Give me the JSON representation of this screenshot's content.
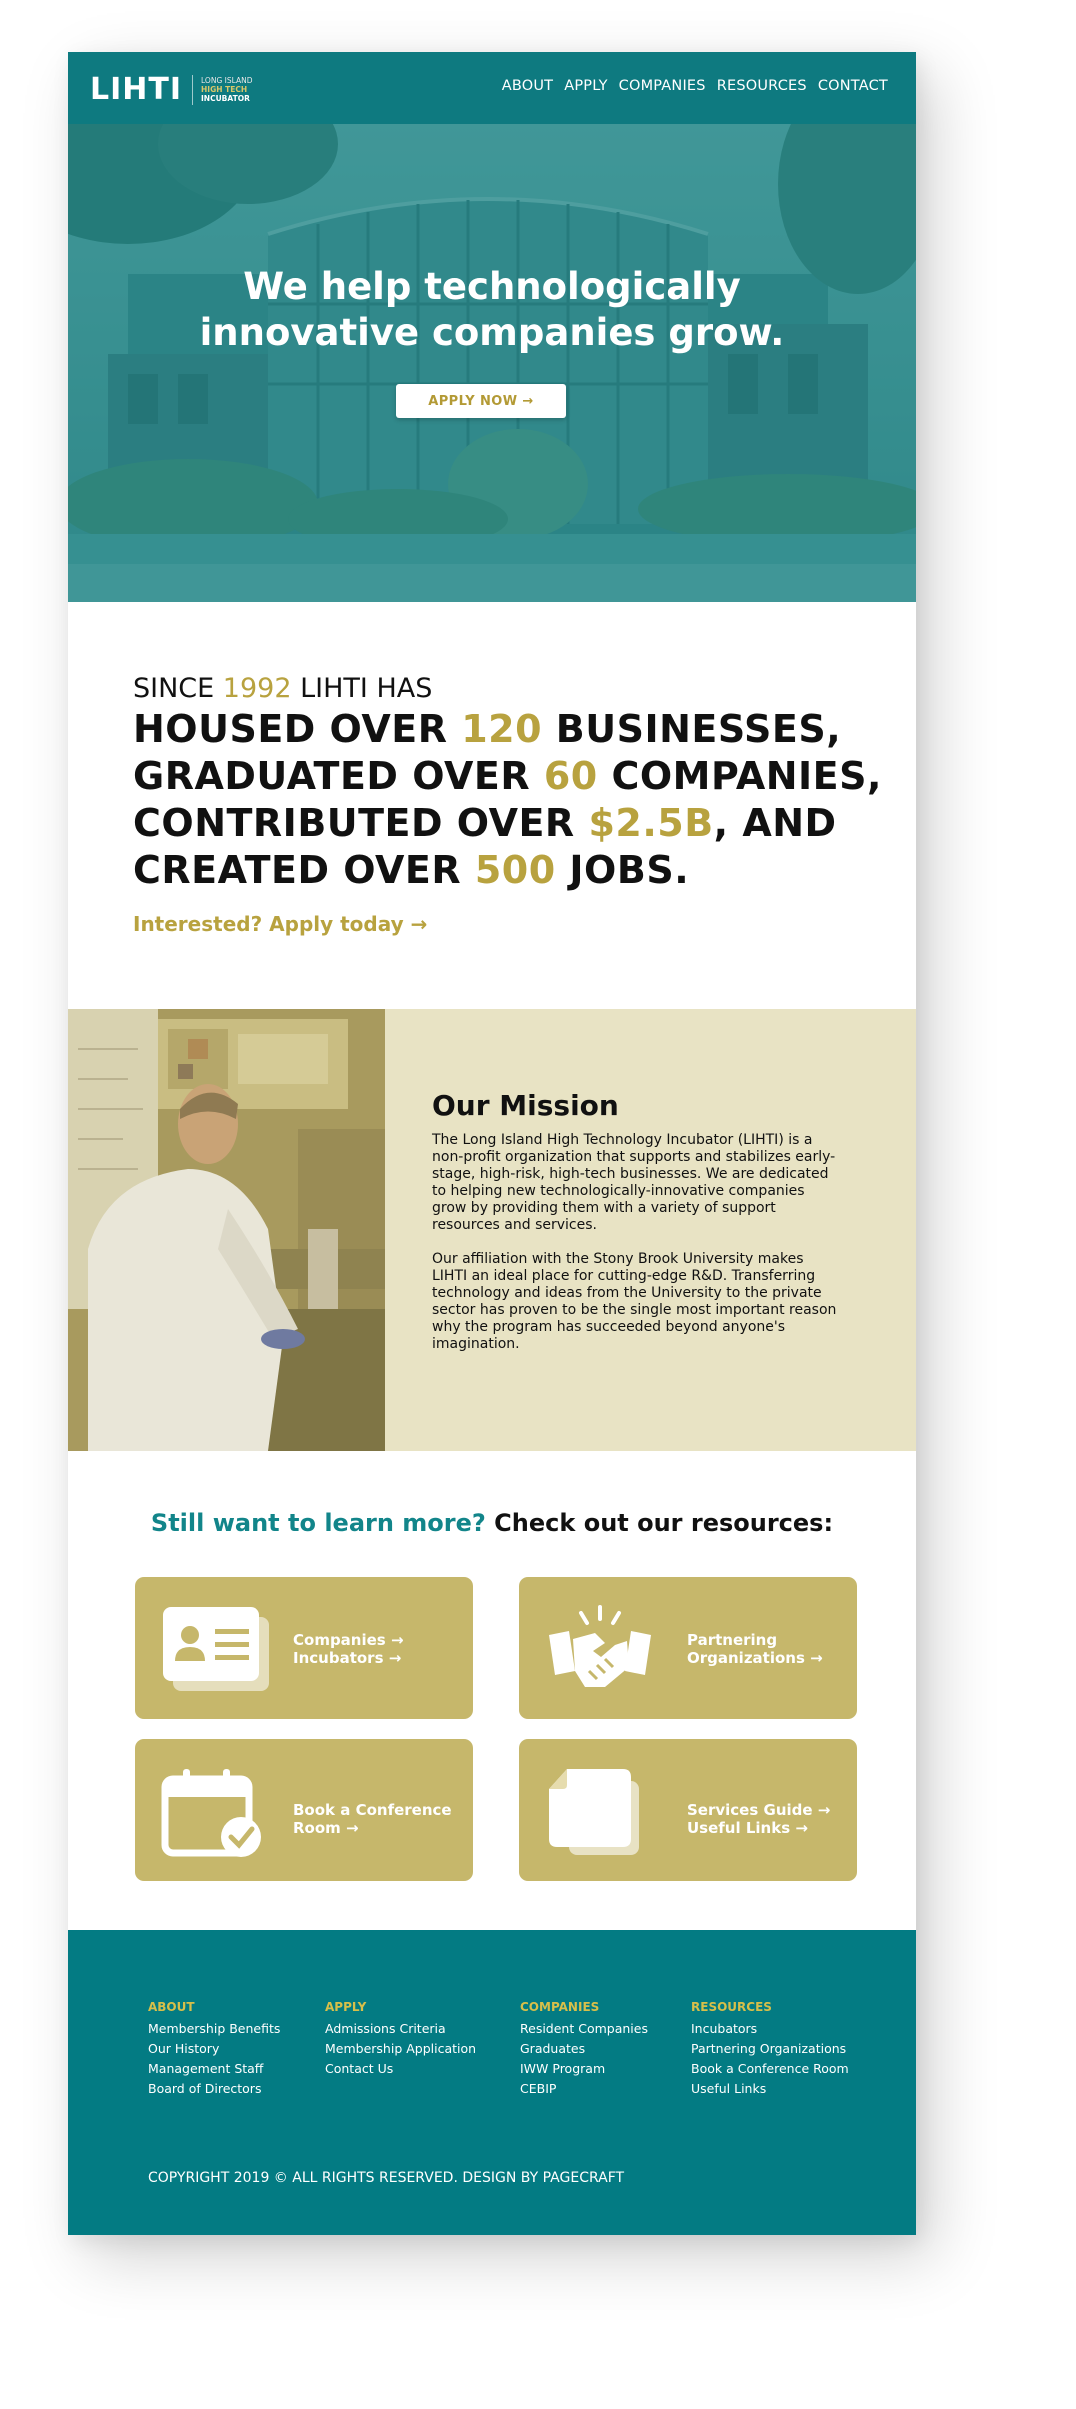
{
  "nav": {
    "logo_main": "LIHTI",
    "logo_line1": "LONG ISLAND",
    "logo_line2": "HIGH TECH",
    "logo_line3": "INCUBATOR",
    "items": [
      {
        "label": "ABOUT"
      },
      {
        "label": "APPLY"
      },
      {
        "label": "COMPANIES"
      },
      {
        "label": "RESOURCES"
      },
      {
        "label": "CONTACT"
      }
    ]
  },
  "hero": {
    "title_line1": "We help technologically",
    "title_line2": "innovative companies grow.",
    "button_label": "APPLY NOW →"
  },
  "stats": {
    "since_prefix": "SINCE ",
    "since_year": "1992",
    "since_suffix": " LIHTI HAS",
    "line1_a": "HOUSED OVER ",
    "line1_num": "120",
    "line1_b": " BUSINESSES,",
    "line2_a": "GRADUATED OVER ",
    "line2_num": "60",
    "line2_b": " COMPANIES,",
    "line3_a": "CONTRIBUTED OVER ",
    "line3_num": "$2.5B",
    "line3_b": ", AND",
    "line4_a": "CREATED OVER ",
    "line4_num": "500",
    "line4_b": " JOBS.",
    "cta": "Interested? Apply today →"
  },
  "mission": {
    "title": "Our Mission",
    "p1": "The Long Island High Technology Incubator (LIHTI) is a non-profit organization that supports and stabilizes early-stage, high-risk, high-tech businesses. We are dedicated to helping new technologically-innovative companies grow by providing them with a variety of support resources and services.",
    "p2": "Our affiliation with the Stony Brook University makes LIHTI an ideal place for cutting-edge R&D.  Transferring technology and ideas from the University to the private sector has proven to be the single most important reason why the program has succeeded beyond anyone's imagination."
  },
  "resources": {
    "heading_teal": "Still want to learn more?",
    "heading_dark": " Check out our resources:",
    "cards": [
      {
        "line1": "Companies →",
        "line2": "Incubators →"
      },
      {
        "line1": "Partnering",
        "line2": "Organizations →"
      },
      {
        "line1": "Book a Conference",
        "line2": "Room →"
      },
      {
        "line1": "Services Guide →",
        "line2": "Useful Links →"
      }
    ]
  },
  "footer": {
    "columns": [
      {
        "title": "ABOUT",
        "links": [
          "Membership Benefits",
          "Our History",
          "Management Staff",
          "Board of Directors"
        ]
      },
      {
        "title": "APPLY",
        "links": [
          "Admissions Criteria",
          "Membership Application",
          "Contact Us"
        ]
      },
      {
        "title": "COMPANIES",
        "links": [
          "Resident Companies",
          "Graduates",
          "IWW Program",
          "CEBIP"
        ]
      },
      {
        "title": "RESOURCES",
        "links": [
          "Incubators",
          "Partnering Organizations",
          "Book a Conference Room",
          "Useful Links"
        ]
      }
    ],
    "copyright": "COPYRIGHT 2019 © ALL RIGHTS RESERVED. DESIGN BY PAGECRAFT"
  },
  "colors": {
    "teal": "#0e7a80",
    "gold": "#b8a23f",
    "card": "#c6b76b",
    "mission_bg": "#e8e3c4"
  }
}
